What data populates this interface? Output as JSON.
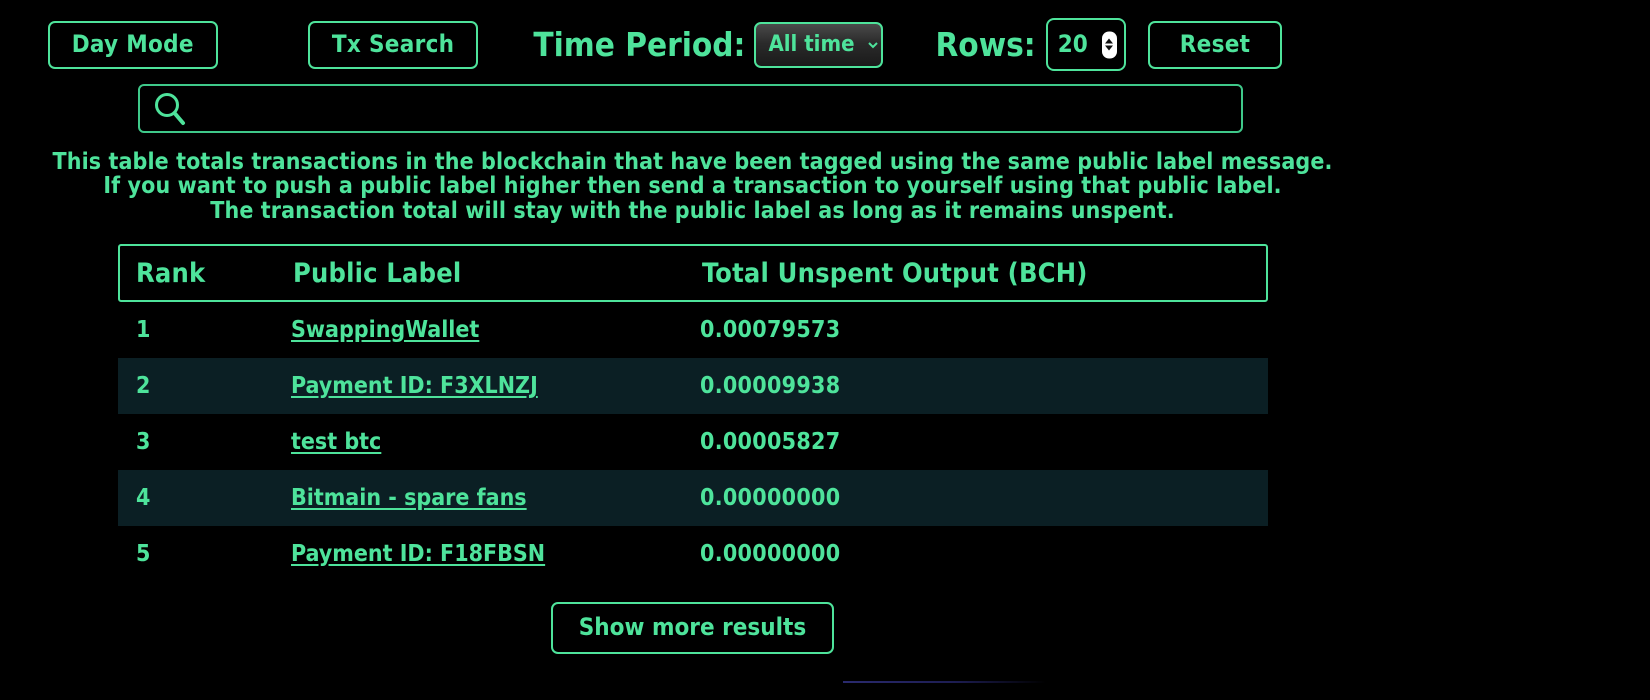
{
  "toolbar": {
    "day_mode_label": "Day Mode",
    "tx_search_label": "Tx Search",
    "time_period_label": "Time Period:",
    "time_period_value": "All time",
    "time_period_options": [
      "All time"
    ],
    "rows_label": "Rows:",
    "rows_value": "20",
    "reset_label": "Reset"
  },
  "search": {
    "value": "",
    "placeholder": "",
    "icon": "search-icon"
  },
  "description": {
    "line1": "This table totals transactions in the blockchain that have been tagged using the same public label message.",
    "line2": "If you want to push a public label higher then send a transaction to yourself using that public label.",
    "line3": "The transaction total will stay with the public label as long as it remains unspent."
  },
  "table": {
    "headers": {
      "rank": "Rank",
      "public_label": "Public Label",
      "total": "Total Unspent Output (BCH)"
    },
    "rows": [
      {
        "rank": "1",
        "label": "SwappingWallet",
        "total": "0.00079573"
      },
      {
        "rank": "2",
        "label": "Payment ID: F3XLNZJ",
        "total": "0.00009938"
      },
      {
        "rank": "3",
        "label": "test btc",
        "total": "0.00005827"
      },
      {
        "rank": "4",
        "label": "Bitmain - spare fans",
        "total": "0.00000000"
      },
      {
        "rank": "5",
        "label": "Payment ID: F18FBSN",
        "total": "0.00000000"
      }
    ]
  },
  "footer": {
    "show_more_label": "Show more results"
  },
  "colors": {
    "accent_green": "#4ee39b",
    "background": "#000000",
    "row_alt": "#0b1f24",
    "rule_blue": "#2a2a6e"
  }
}
